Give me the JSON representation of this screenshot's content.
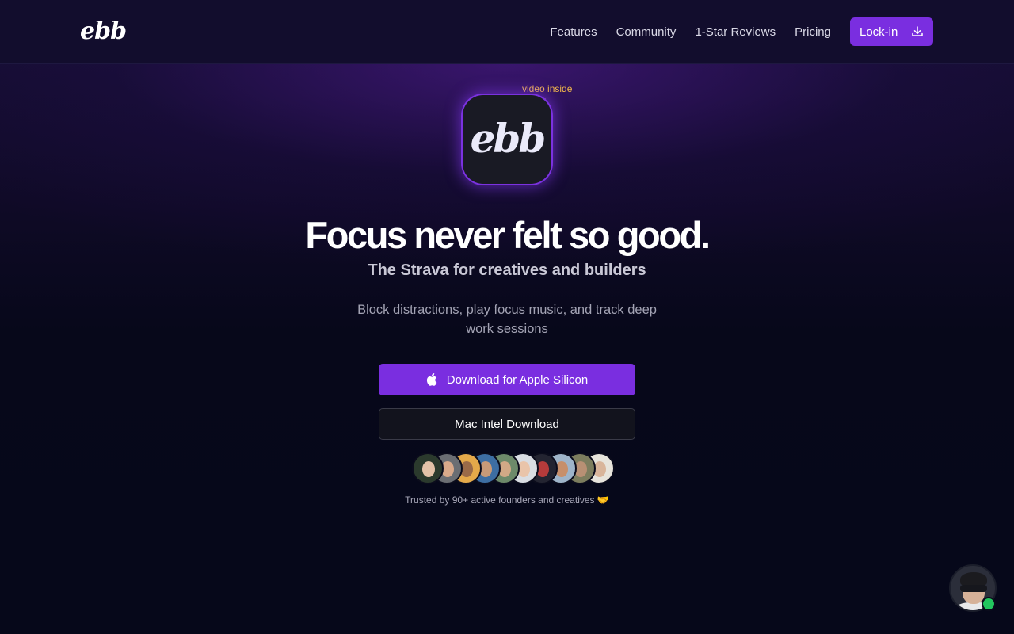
{
  "nav": {
    "logo": "ebb",
    "links": [
      "Features",
      "Community",
      "1-Star Reviews",
      "Pricing"
    ],
    "cta_label": "Lock-in",
    "cta_icon": "download-icon"
  },
  "hero": {
    "app_icon_text": "ebb",
    "video_tag": "video inside",
    "headline": "Focus never felt so good.",
    "subheadline": "The Strava for creatives and builders",
    "description": "Block distractions, play focus music, and track deep work sessions",
    "primary_button": "Download for Apple Silicon",
    "primary_button_icon": "apple-icon",
    "secondary_button": "Mac Intel Download",
    "trust_text": "Trusted by 90+ active founders and creatives 🤝"
  },
  "avatars": [
    {
      "bg": "#2b3a2d",
      "face": "#e3c2a8"
    },
    {
      "bg": "#6b6e73",
      "face": "#d9a98a"
    },
    {
      "bg": "#e4a94a",
      "face": "#9a6a48"
    },
    {
      "bg": "#3d6ea3",
      "face": "#c89a78"
    },
    {
      "bg": "#6d8a6a",
      "face": "#d2a986"
    },
    {
      "bg": "#d9dde3",
      "face": "#e9c4aa"
    },
    {
      "bg": "#232431",
      "face": "#b53b3b"
    },
    {
      "bg": "#9eb4c9",
      "face": "#c78f6a"
    },
    {
      "bg": "#7c7d5e",
      "face": "#b89074"
    },
    {
      "bg": "#e7e4dc",
      "face": "#d9b59b"
    }
  ],
  "colors": {
    "accent": "#7a2ee0",
    "video_tag": "#f2b84b",
    "online": "#22c55e"
  }
}
